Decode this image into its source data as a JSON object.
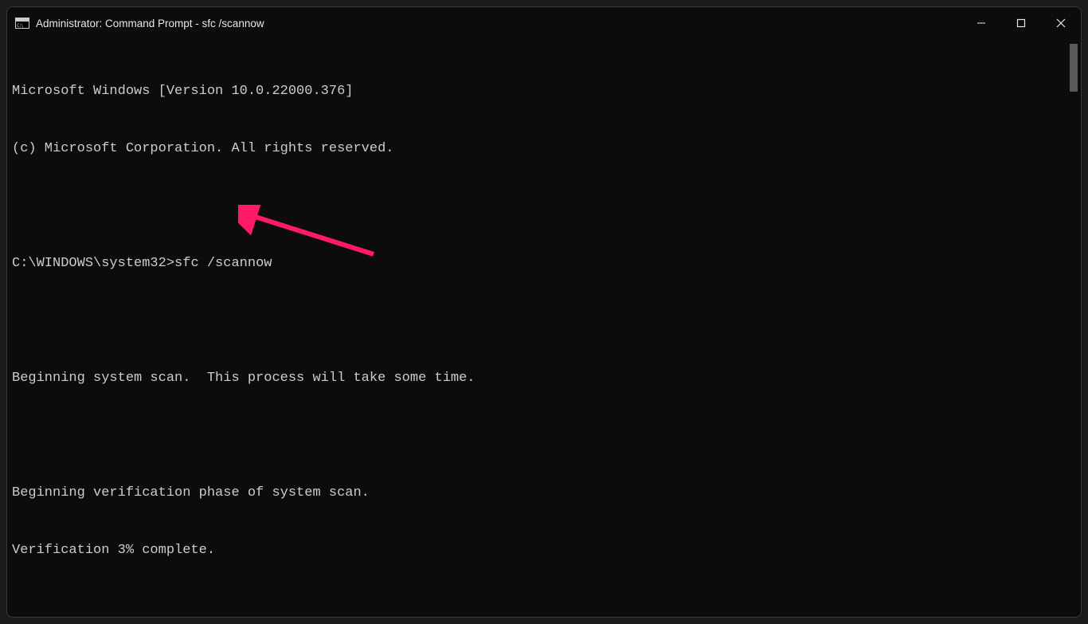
{
  "window": {
    "title": "Administrator: Command Prompt - sfc  /scannow"
  },
  "terminal": {
    "line1": "Microsoft Windows [Version 10.0.22000.376]",
    "line2": "(c) Microsoft Corporation. All rights reserved.",
    "prompt": "C:\\WINDOWS\\system32>",
    "command": "sfc /scannow",
    "line4": "Beginning system scan.  This process will take some time.",
    "line5": "Beginning verification phase of system scan.",
    "line6": "Verification 3% complete."
  },
  "annotation": {
    "arrow_color": "#ff1a66"
  }
}
